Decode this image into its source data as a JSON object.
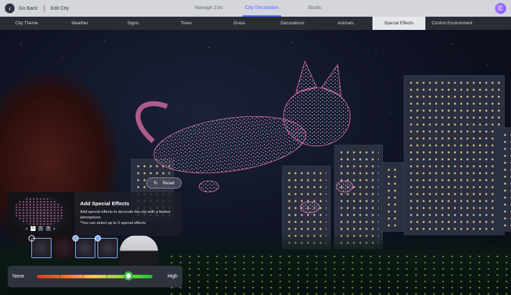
{
  "topbar": {
    "back_label": "Go Back",
    "edit_label": "Edit City",
    "tabs": [
      "Manage Zois",
      "City Decoration",
      "Studio"
    ],
    "active_tab_index": 1,
    "avatar_letter": "C"
  },
  "categories": {
    "items": [
      "City Theme",
      "Weather",
      "Signs",
      "Trees",
      "Grass",
      "Decorations",
      "Animals",
      "Special Effects",
      "Control Environment"
    ],
    "active_index": 7
  },
  "reset_button": {
    "label": "Reset",
    "icon": "refresh-icon"
  },
  "effects_panel": {
    "title": "Add Special Effects",
    "description": "Add special effects to decorate the city with a festive atmosphere.",
    "note": "*You can select up to 3 special effects.",
    "pager": {
      "pages": [
        "1",
        "2",
        "3"
      ],
      "current": "1"
    }
  },
  "intensity_slider": {
    "min_label": "None",
    "max_label": "High",
    "value_fraction": 0.79
  },
  "colors": {
    "accent": "#4a6dff",
    "topbar_bg": "#d4d6dc",
    "category_bar_bg": "#2b2d35",
    "thumbnail_border": "#86b7ff"
  }
}
